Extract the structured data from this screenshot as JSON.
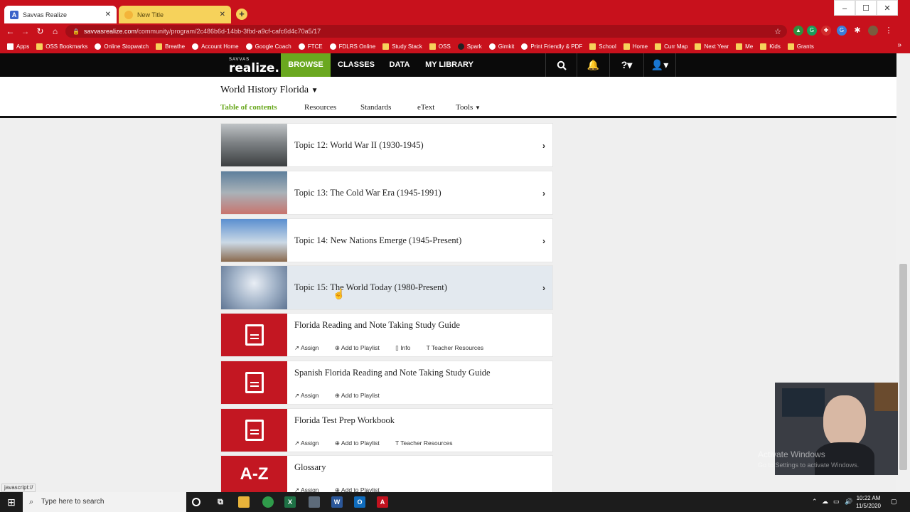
{
  "browser": {
    "tabs": [
      {
        "title": "Savvas Realize",
        "active": true
      },
      {
        "title": "New Title",
        "active": false
      }
    ],
    "window_controls": [
      "–",
      "☐",
      "✕"
    ],
    "url_host": "savvasrealize.com",
    "url_path": "/community/program/2c486b6d-14bb-3fbd-a9cf-cafc6d4c70a5/17",
    "bookmarks": [
      "Apps",
      "OSS Bookmarks",
      "Online Stopwatch",
      "Breathe",
      "Account Home",
      "Google Coach",
      "FTCE",
      "FDLRS Online",
      "Study Stack",
      "OSS",
      "Spark",
      "Gimkit",
      "Print Friendly & PDF",
      "School",
      "Home",
      "Curr Map",
      "Next Year",
      "Me",
      "Kids",
      "Grants"
    ],
    "accent_color": "#c8111c"
  },
  "app": {
    "logo_small": "SAVVAS",
    "logo_big": "realize.",
    "nav": [
      "BROWSE",
      "CLASSES",
      "DATA",
      "MY LIBRARY"
    ],
    "program_title": "World History Florida",
    "subtabs": [
      "Table of contents",
      "Resources",
      "Standards",
      "eText",
      "Tools"
    ],
    "brand_green": "#6aa81f"
  },
  "items": [
    {
      "title": "Topic 12: World War II (1930-1945)"
    },
    {
      "title": "Topic 13: The Cold War Era (1945-1991)"
    },
    {
      "title": "Topic 14: New Nations Emerge (1945-Present)"
    },
    {
      "title": "Topic 15: The World Today (1980-Present)"
    },
    {
      "title": "Florida Reading and Note Taking Study Guide",
      "actions": [
        "Assign",
        "Add to Playlist",
        "Info",
        "Teacher Resources"
      ]
    },
    {
      "title": "Spanish Florida Reading and Note Taking Study Guide",
      "actions": [
        "Assign",
        "Add to Playlist"
      ]
    },
    {
      "title": "Florida Test Prep Workbook",
      "actions": [
        "Assign",
        "Add to Playlist",
        "Teacher Resources"
      ]
    },
    {
      "title": "Glossary",
      "thumb_text": "A-Z",
      "actions": [
        "Assign",
        "Add to Playlist"
      ]
    }
  ],
  "overlay": {
    "activate_title": "Activate Windows",
    "activate_sub": "Go to Settings to activate Windows.",
    "status_text": "javascript://"
  },
  "taskbar": {
    "search_placeholder": "Type here to search",
    "time": "10:22 AM",
    "date": "11/5/2020"
  }
}
